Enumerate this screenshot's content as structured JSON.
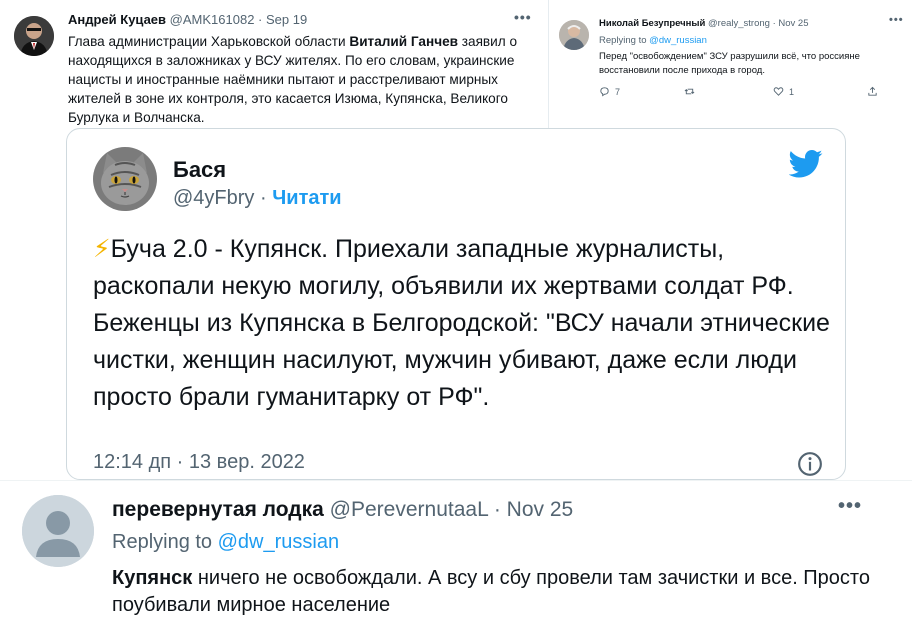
{
  "tweet_top_left": {
    "author": "Андрей Куцаев",
    "handle": "@AMK161082",
    "date": "Sep 19",
    "text_before": "Глава администрации Харьковской области ",
    "text_bold": "Виталий Ганчев",
    "text_after": " заявил о находящихся в заложниках у ВСУ жителях. По его словам, украинские нацисты и иностранные наёмники пытают и расстреливают мирных жителей в зоне их контроля, это касается Изюма, Купянска, Великого Бурлука и Волчанска."
  },
  "tweet_top_right": {
    "author": "Николай Безупречный",
    "handle": "@realy_strong",
    "date": "Nov 25",
    "replying_prefix": "Replying to",
    "replying_handle": "@dw_russian",
    "text": "Перед \"освобождением\" ЗСУ разрушили всё, что россияне восстановили после прихода в город.",
    "reply_count": "7",
    "like_count": "1",
    "icons": [
      "reply-icon",
      "retweet-icon",
      "like-icon",
      "share-icon"
    ]
  },
  "embedded_tweet": {
    "author": "Бася",
    "handle": "@4yFbry",
    "follow_label": "Читати",
    "text_emoji": "⚡",
    "text": "Буча 2.0 - Купянск. Приехали западные журналисты, раскопали некую могилу, объявили их жертвами солдат РФ. Беженцы из Купянска в Белгородской: \"ВСУ начали этнические чистки, женщин насилуют, мужчин убивают, даже если люди просто брали гуманитарку от РФ\".",
    "timestamp": "12:14 дп · 13 вер. 2022",
    "brand_color": "#1d9bf0",
    "icons": [
      "twitter-bird-icon",
      "info-icon"
    ]
  },
  "tweet_bottom": {
    "author": "перевернутая лодка",
    "handle": "@PerevernutaaL",
    "date": "Nov 25",
    "replying_prefix": "Replying to",
    "replying_handle": "@dw_russian",
    "text_bold": "Купянск",
    "text_rest": " ничего не освобождали. А всу и сбу провели там зачистки и все. Просто поубивали мирное население"
  },
  "separator": "·",
  "more_glyph": "•••"
}
